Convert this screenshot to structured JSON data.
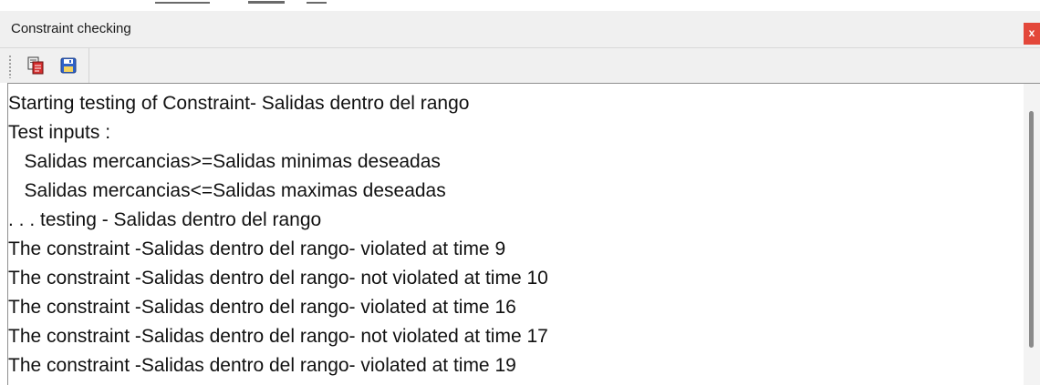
{
  "window": {
    "title": "Constraint checking",
    "close_label": "x"
  },
  "toolbar": {
    "buttons": [
      {
        "icon": "copy-icon"
      },
      {
        "icon": "save-icon"
      }
    ]
  },
  "log": {
    "lines": [
      "Starting testing of Constraint- Salidas dentro del rango",
      "Test inputs :",
      "   Salidas mercancias>=Salidas minimas deseadas",
      "   Salidas mercancias<=Salidas maximas deseadas",
      ". . . testing - Salidas dentro del rango",
      "The constraint -Salidas dentro del rango- violated at time 9",
      "The constraint -Salidas dentro del rango- not violated at time 10",
      "The constraint -Salidas dentro del rango- violated at time 16",
      "The constraint -Salidas dentro del rango- not violated at time 17",
      "The constraint -Salidas dentro del rango- violated at time 19"
    ]
  },
  "colors": {
    "close_button": "#e3473a",
    "chrome": "#f0f0f0",
    "text": "#111111"
  }
}
